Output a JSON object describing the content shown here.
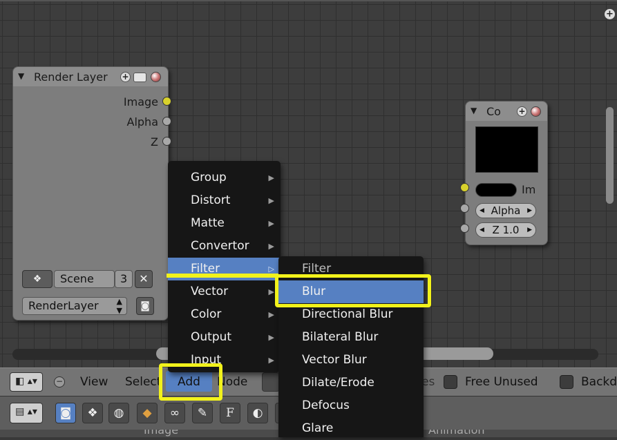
{
  "render_layer_node": {
    "title": "Render Layer",
    "outputs": [
      "Image",
      "Alpha",
      "Z"
    ],
    "scene_label": "Scene",
    "scene_users": "3",
    "layer_select": "RenderLayer"
  },
  "composite_node": {
    "title": "Co",
    "input_label": "Im",
    "alpha_field": "Alpha",
    "z_field": "Z 1.0"
  },
  "add_menu": {
    "items": [
      "Group",
      "Distort",
      "Matte",
      "Convertor",
      "Filter",
      "Vector",
      "Color",
      "Output",
      "Input"
    ],
    "active_item": "Filter"
  },
  "filter_submenu": {
    "items": [
      "Filter",
      "Blur",
      "Directional Blur",
      "Bilateral Blur",
      "Vector Blur",
      "Dilate/Erode",
      "Defocus",
      "Glare"
    ],
    "active_item": "Blur"
  },
  "header": {
    "view": "View",
    "select": "Select",
    "add": "Add",
    "node": "Node",
    "use_nodes": "Use Nodes",
    "free_unused": "Free Unused",
    "backdrop": "Backd"
  },
  "properties_strip": {
    "left_text": "Image",
    "right_text": "Animation"
  },
  "colors": {
    "accent": "#5680c2",
    "highlight": "#f2f21b",
    "socket_image": "#d8d12c",
    "socket_value": "#a8a8a8"
  }
}
